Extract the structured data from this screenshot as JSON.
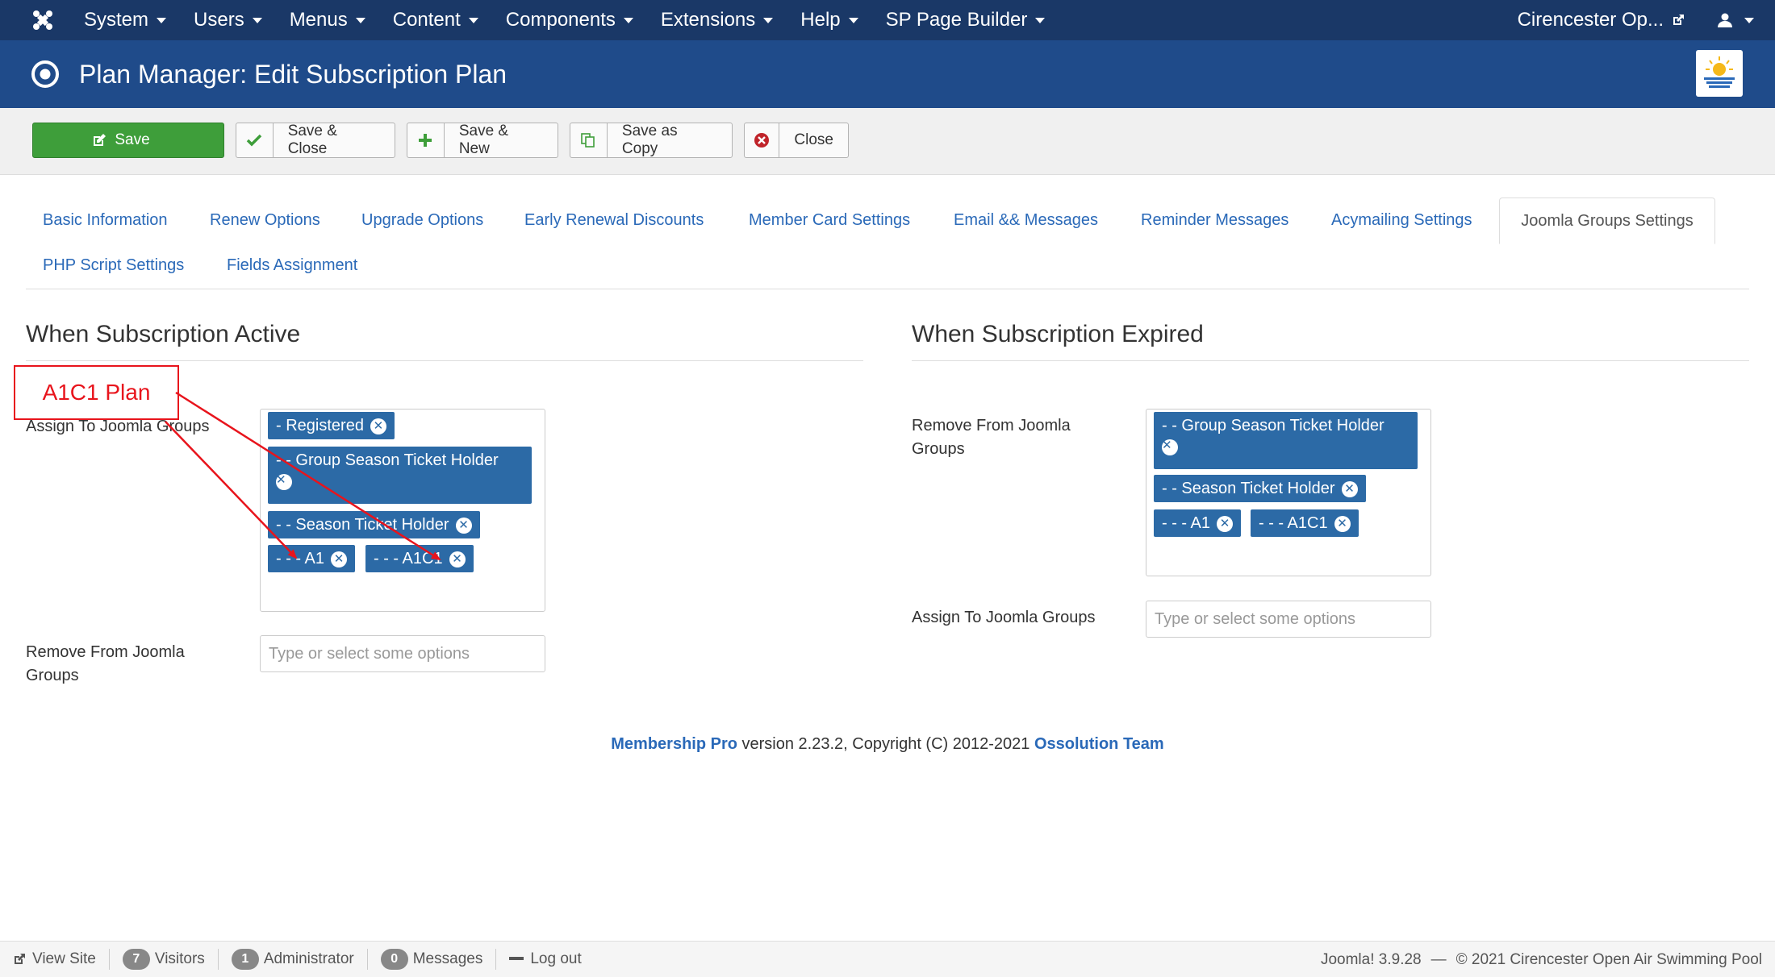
{
  "navbar": {
    "menu": [
      "System",
      "Users",
      "Menus",
      "Content",
      "Components",
      "Extensions",
      "Help",
      "SP Page Builder"
    ],
    "site_name": "Cirencester Op..."
  },
  "header": {
    "title": "Plan Manager: Edit Subscription Plan"
  },
  "toolbar": {
    "save": "Save",
    "save_close": "Save & Close",
    "save_new": "Save & New",
    "save_copy": "Save as Copy",
    "close": "Close"
  },
  "tabs": {
    "row1": [
      "Basic Information",
      "Renew Options",
      "Upgrade Options",
      "Early Renewal Discounts",
      "Member Card Settings",
      "Email && Messages",
      "Reminder Messages",
      "Acymailing Settings"
    ],
    "active": "Joomla Groups Settings",
    "row2": [
      "PHP Script Settings",
      "Fields Assignment"
    ]
  },
  "active_section": {
    "title": "When Subscription Active",
    "assign_label": "Assign To Joomla Groups",
    "assign_chips": [
      "- Registered",
      "- - Group Season Ticket Holder",
      "- - Season Ticket Holder",
      "- - - A1",
      "- - - A1C1"
    ],
    "remove_label": "Remove From Joomla Groups",
    "remove_placeholder": "Type or select some options"
  },
  "expired_section": {
    "title": "When Subscription Expired",
    "remove_label": "Remove From Joomla Groups",
    "remove_chips": [
      "- - Group Season Ticket Holder",
      "- - Season Ticket Holder",
      "- - - A1",
      "- - - A1C1"
    ],
    "assign_label": "Assign To Joomla Groups",
    "assign_placeholder": "Type or select some options"
  },
  "footer": {
    "product": "Membership Pro",
    "version_text": " version 2.23.2, Copyright (C) 2012-2021 ",
    "team": "Ossolution Team"
  },
  "statusbar": {
    "view_site": "View Site",
    "visitors_count": "7",
    "visitors": "Visitors",
    "admin_count": "1",
    "admin": "Administrator",
    "messages_count": "0",
    "messages": "Messages",
    "logout": "Log out",
    "version": "Joomla! 3.9.28",
    "copyright": "© 2021 Cirencester Open Air Swimming Pool"
  },
  "annotation": {
    "label": "A1C1 Plan",
    "color": "#e8141c"
  },
  "colors": {
    "navbar": "#1a3867",
    "header": "#1f4b8a",
    "save_button": "#3e9e3a",
    "chip": "#2c6aa6",
    "link": "#2a69b8"
  }
}
